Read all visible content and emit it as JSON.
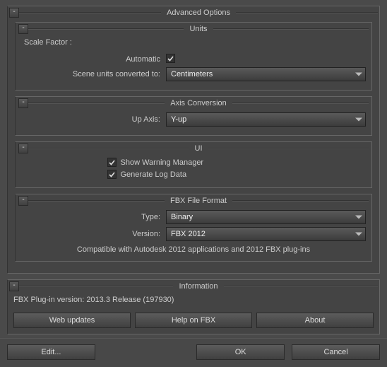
{
  "advanced": {
    "title": "Advanced Options",
    "units": {
      "title": "Units",
      "scale_factor_label": "Scale Factor :",
      "automatic_label": "Automatic",
      "automatic_checked": true,
      "converted_label": "Scene units converted to:",
      "converted_value": "Centimeters"
    },
    "axis": {
      "title": "Axis Conversion",
      "up_label": "Up Axis:",
      "up_value": "Y-up"
    },
    "ui": {
      "title": "UI",
      "warning_label": "Show Warning Manager",
      "warning_checked": true,
      "log_label": "Generate Log Data",
      "log_checked": true
    },
    "fbx": {
      "title": "FBX File Format",
      "type_label": "Type:",
      "type_value": "Binary",
      "version_label": "Version:",
      "version_value": "FBX 2012",
      "compat_text": "Compatible with Autodesk 2012 applications and 2012 FBX plug-ins"
    }
  },
  "information": {
    "title": "Information",
    "plugin_text": "FBX Plug-in version: 2013.3 Release (197930)",
    "web_btn": "Web updates",
    "help_btn": "Help on FBX",
    "about_btn": "About"
  },
  "footer": {
    "edit": "Edit...",
    "ok": "OK",
    "cancel": "Cancel"
  },
  "collapse_glyph": "-"
}
